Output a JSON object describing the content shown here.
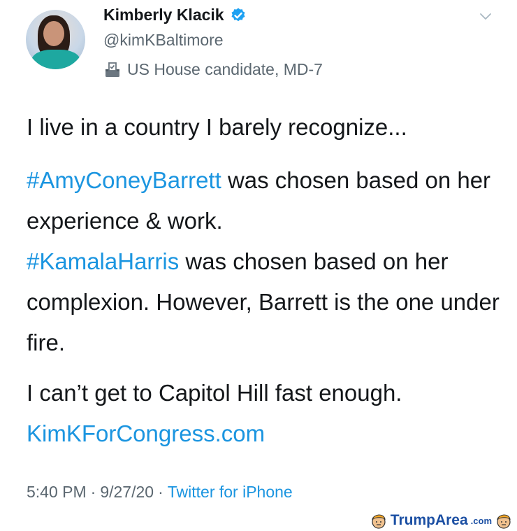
{
  "author": {
    "display_name": "Kimberly Klacik",
    "handle": "@kimKBaltimore",
    "bio_label": "US House candidate, MD-7"
  },
  "tweet": {
    "line1": "I live in a country I barely recognize...",
    "hashtag1": "#AmyConeyBarrett",
    "text1": " was chosen based on her experience & work.",
    "hashtag2": "#KamalaHarris",
    "text2": " was chosen based on her complexion. However, Barrett is the one under fire.",
    "line3": "I can’t get to Capitol Hill fast enough.",
    "link": "KimKForCongress.com"
  },
  "meta": {
    "time": "5:40 PM",
    "sep1": "·",
    "date": "9/27/20",
    "sep2": "·",
    "source": "Twitter for iPhone"
  },
  "watermark": {
    "brand": "TrumpArea",
    "suffix": ".com"
  },
  "icons": [
    "verified-badge-icon",
    "ballot-box-icon",
    "chevron-down-icon",
    "cartoon-face-icon"
  ],
  "colors": {
    "link": "#1b95e0",
    "verified": "#1da1f2",
    "muted": "#5b6770",
    "text": "#14171a"
  }
}
